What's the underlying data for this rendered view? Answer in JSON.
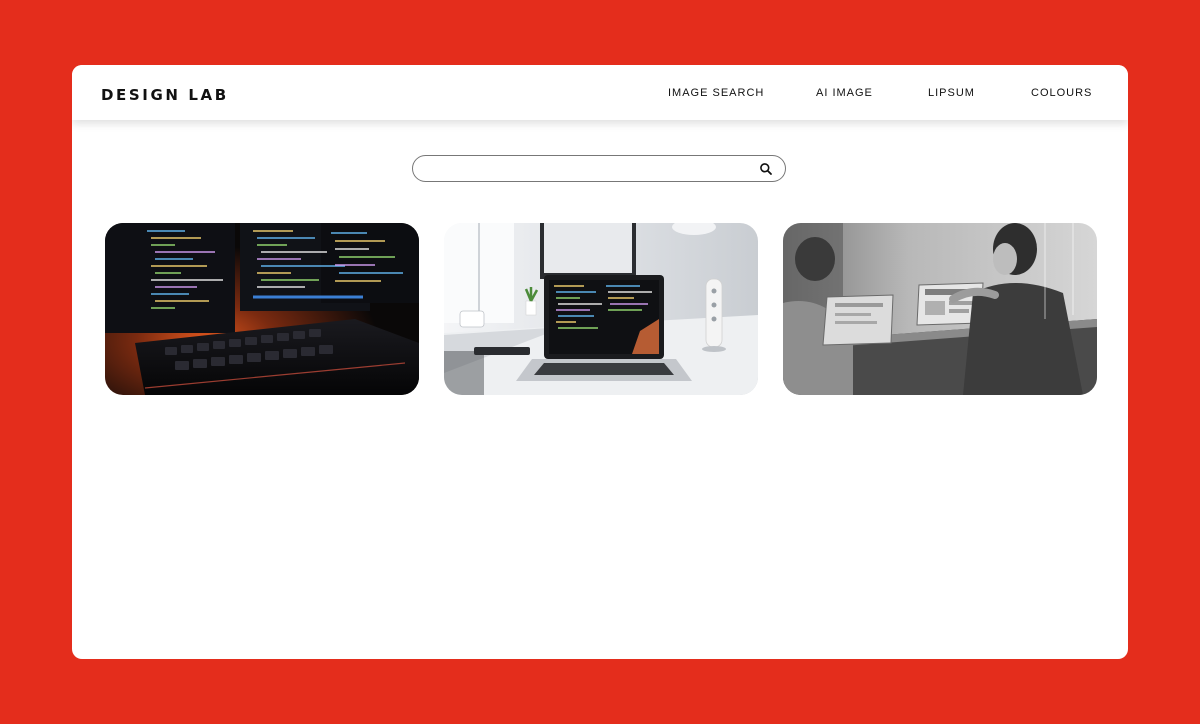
{
  "brand": {
    "logo": "DESIGN LAB"
  },
  "nav": {
    "items": [
      {
        "label": "IMAGE SEARCH"
      },
      {
        "label": "AI IMAGE"
      },
      {
        "label": "LIPSUM"
      },
      {
        "label": "COLOURS"
      }
    ]
  },
  "search": {
    "value": "",
    "placeholder": "",
    "icon": "search-icon"
  },
  "gallery": {
    "images": [
      {
        "subject": "keyboard-and-code-monitors-photo"
      },
      {
        "subject": "laptop-on-desk-photo"
      },
      {
        "subject": "people-working-on-laptops-photo"
      }
    ]
  },
  "colors": {
    "background": "#E42D1C",
    "panel": "#FFFFFF",
    "text": "#111111"
  }
}
